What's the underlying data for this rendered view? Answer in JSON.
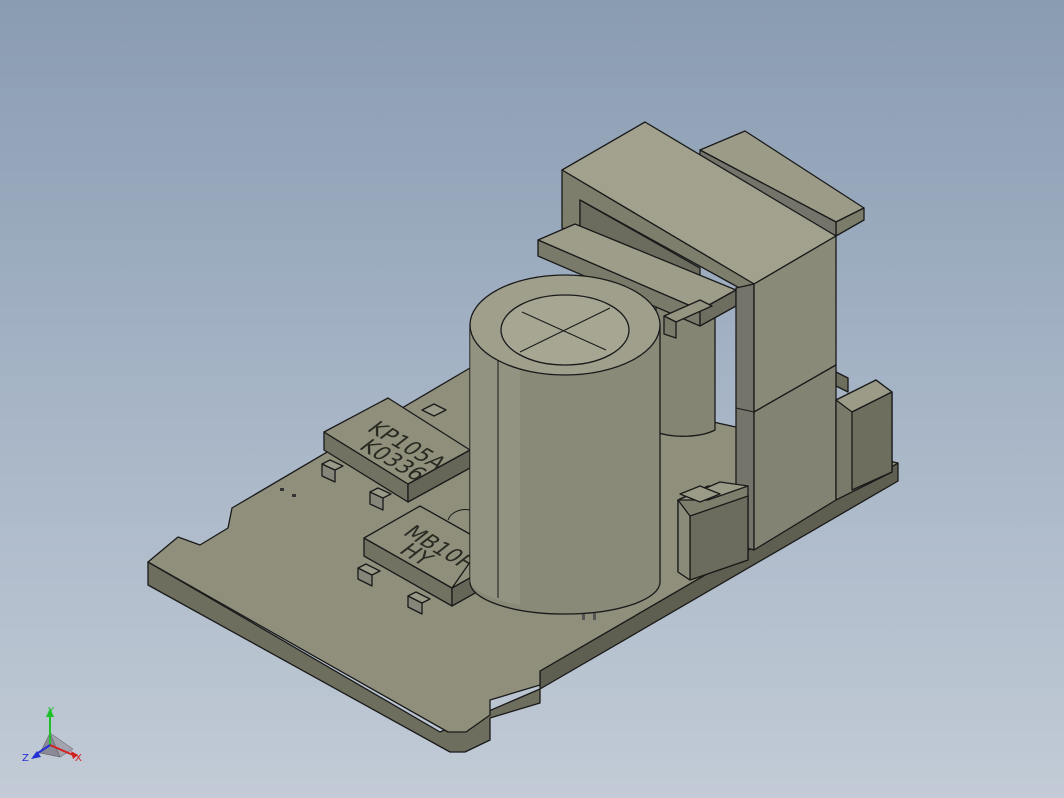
{
  "viewport": {
    "background_top": "#8a9cb2",
    "background_bottom": "#c2cbd6",
    "model_color": "#8f8f7c"
  },
  "model": {
    "chip1": {
      "line1": "KP105A",
      "line2": "K0336"
    },
    "chip2": {
      "line1": "MB10F",
      "line2": "HY"
    }
  },
  "triad": {
    "y_label": "Y",
    "x_label": "X",
    "z_label": "Z",
    "y_color": "#1fbf2a",
    "x_color": "#d42020",
    "z_color": "#2430d4"
  }
}
